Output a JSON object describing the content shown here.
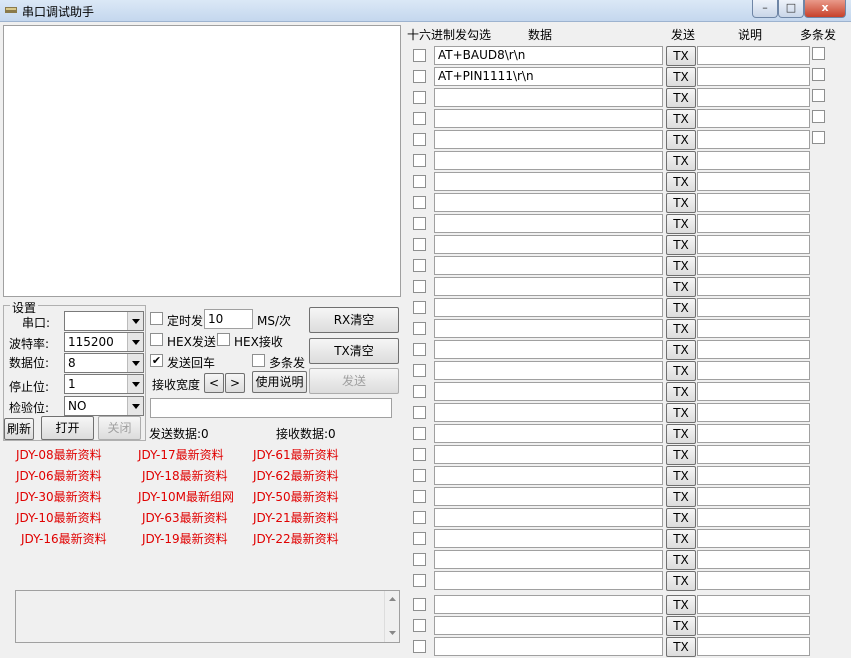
{
  "window": {
    "title": "串口调试助手",
    "minimize_label": "–",
    "maximize_label": "□",
    "close_label": "x"
  },
  "settings": {
    "legend": "设置",
    "port_label": "串口:",
    "port_value": "",
    "baud_label": "波特率:",
    "baud_value": "115200",
    "databits_label": "数据位:",
    "databits_value": "8",
    "stopbits_label": "停止位:",
    "stopbits_value": "1",
    "parity_label": "检验位:",
    "parity_value": "NO",
    "refresh_label": "刷新",
    "open_label": "打开",
    "close_label": "关闭"
  },
  "controls": {
    "timed_send_label": "定时发",
    "timed_send_checked": false,
    "interval_value": "10",
    "interval_unit": "MS/次",
    "hex_send_label": "HEX发送",
    "hex_send_checked": false,
    "hex_recv_label": "HEX接收",
    "hex_recv_checked": false,
    "send_newline_label": "发送回车",
    "send_newline_checked": true,
    "multi_send_label": "多条发",
    "multi_send_checked": false,
    "recv_width_label": "接收宽度",
    "prev_label": "<",
    "next_label": ">",
    "manual_label": "使用说明",
    "rx_clear_label": "RX清空",
    "tx_clear_label": "TX清空",
    "send_label": "发送",
    "send_input_value": "",
    "sent_count_label": "发送数据:",
    "sent_count": "0",
    "recv_count_label": "接收数据:",
    "recv_count": "0"
  },
  "links": [
    {
      "label": "JDY-08最新资料",
      "color": "#e00000"
    },
    {
      "label": "JDY-17最新资料",
      "color": "#e00000"
    },
    {
      "label": "JDY-61最新资料",
      "color": "#e00000"
    },
    {
      "label": "JDY-06最新资料",
      "color": "#e00000"
    },
    {
      "label": "JDY-18最新资料",
      "color": "#e00000"
    },
    {
      "label": "JDY-62最新资料",
      "color": "#e00000"
    },
    {
      "label": "JDY-30最新资料",
      "color": "#e00000"
    },
    {
      "label": "JDY-10M最新组网",
      "color": "#e00000"
    },
    {
      "label": "JDY-50最新资料",
      "color": "#e00000"
    },
    {
      "label": "JDY-10最新资料",
      "color": "#e00000"
    },
    {
      "label": "JDY-63最新资料",
      "color": "#e00000"
    },
    {
      "label": "JDY-21最新资料",
      "color": "#e00000"
    },
    {
      "label": "JDY-16最新资料",
      "color": "#e00000"
    },
    {
      "label": "JDY-19最新资料",
      "color": "#e00000"
    },
    {
      "label": "JDY-22最新资料",
      "color": "#e00000"
    }
  ],
  "table": {
    "headers": {
      "hex": "十六进制发勾选",
      "data": "数据",
      "send": "发送",
      "desc": "说明",
      "multi": "多条发"
    },
    "tx_label": "TX",
    "rows": [
      {
        "hex": false,
        "data": "AT+BAUD8\\r\\n",
        "desc": "",
        "multi": false,
        "has_multi": true
      },
      {
        "hex": false,
        "data": "AT+PIN1111\\r\\n",
        "desc": "",
        "multi": false,
        "has_multi": true
      },
      {
        "hex": false,
        "data": "",
        "desc": "",
        "multi": false,
        "has_multi": true
      },
      {
        "hex": false,
        "data": "",
        "desc": "",
        "multi": false,
        "has_multi": true
      },
      {
        "hex": false,
        "data": "",
        "desc": "",
        "multi": false,
        "has_multi": true
      },
      {
        "hex": false,
        "data": "",
        "desc": "",
        "has_multi": false
      },
      {
        "hex": false,
        "data": "",
        "desc": "",
        "has_multi": false
      },
      {
        "hex": false,
        "data": "",
        "desc": "",
        "has_multi": false
      },
      {
        "hex": false,
        "data": "",
        "desc": "",
        "has_multi": false
      },
      {
        "hex": false,
        "data": "",
        "desc": "",
        "has_multi": false
      },
      {
        "hex": false,
        "data": "",
        "desc": "",
        "has_multi": false
      },
      {
        "hex": false,
        "data": "",
        "desc": "",
        "has_multi": false
      },
      {
        "hex": false,
        "data": "",
        "desc": "",
        "has_multi": false
      },
      {
        "hex": false,
        "data": "",
        "desc": "",
        "has_multi": false
      },
      {
        "hex": false,
        "data": "",
        "desc": "",
        "has_multi": false
      },
      {
        "hex": false,
        "data": "",
        "desc": "",
        "has_multi": false
      },
      {
        "hex": false,
        "data": "",
        "desc": "",
        "has_multi": false
      },
      {
        "hex": false,
        "data": "",
        "desc": "",
        "has_multi": false
      },
      {
        "hex": false,
        "data": "",
        "desc": "",
        "has_multi": false
      },
      {
        "hex": false,
        "data": "",
        "desc": "",
        "has_multi": false
      },
      {
        "hex": false,
        "data": "",
        "desc": "",
        "has_multi": false
      },
      {
        "hex": false,
        "data": "",
        "desc": "",
        "has_multi": false
      },
      {
        "hex": false,
        "data": "",
        "desc": "",
        "has_multi": false
      },
      {
        "hex": false,
        "data": "",
        "desc": "",
        "has_multi": false
      },
      {
        "hex": false,
        "data": "",
        "desc": "",
        "has_multi": false
      },
      {
        "hex": false,
        "data": "",
        "desc": "",
        "has_multi": false
      },
      {
        "hex": false,
        "data": "",
        "desc": "",
        "has_multi": false
      },
      {
        "hex": false,
        "data": "",
        "desc": "",
        "has_multi": false
      },
      {
        "hex": false,
        "data": "",
        "desc": "",
        "has_multi": false
      },
      {
        "hex": false,
        "data": "",
        "desc": "",
        "has_multi": false
      }
    ]
  }
}
